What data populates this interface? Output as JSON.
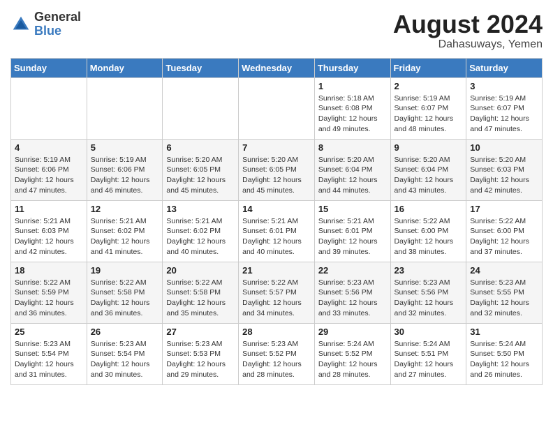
{
  "logo": {
    "general": "General",
    "blue": "Blue"
  },
  "title": {
    "month_year": "August 2024",
    "location": "Dahasuways, Yemen"
  },
  "weekdays": [
    "Sunday",
    "Monday",
    "Tuesday",
    "Wednesday",
    "Thursday",
    "Friday",
    "Saturday"
  ],
  "weeks": [
    [
      {
        "day": "",
        "info": ""
      },
      {
        "day": "",
        "info": ""
      },
      {
        "day": "",
        "info": ""
      },
      {
        "day": "",
        "info": ""
      },
      {
        "day": "1",
        "info": "Sunrise: 5:18 AM\nSunset: 6:08 PM\nDaylight: 12 hours and 49 minutes."
      },
      {
        "day": "2",
        "info": "Sunrise: 5:19 AM\nSunset: 6:07 PM\nDaylight: 12 hours and 48 minutes."
      },
      {
        "day": "3",
        "info": "Sunrise: 5:19 AM\nSunset: 6:07 PM\nDaylight: 12 hours and 47 minutes."
      }
    ],
    [
      {
        "day": "4",
        "info": "Sunrise: 5:19 AM\nSunset: 6:06 PM\nDaylight: 12 hours and 47 minutes."
      },
      {
        "day": "5",
        "info": "Sunrise: 5:19 AM\nSunset: 6:06 PM\nDaylight: 12 hours and 46 minutes."
      },
      {
        "day": "6",
        "info": "Sunrise: 5:20 AM\nSunset: 6:05 PM\nDaylight: 12 hours and 45 minutes."
      },
      {
        "day": "7",
        "info": "Sunrise: 5:20 AM\nSunset: 6:05 PM\nDaylight: 12 hours and 45 minutes."
      },
      {
        "day": "8",
        "info": "Sunrise: 5:20 AM\nSunset: 6:04 PM\nDaylight: 12 hours and 44 minutes."
      },
      {
        "day": "9",
        "info": "Sunrise: 5:20 AM\nSunset: 6:04 PM\nDaylight: 12 hours and 43 minutes."
      },
      {
        "day": "10",
        "info": "Sunrise: 5:20 AM\nSunset: 6:03 PM\nDaylight: 12 hours and 42 minutes."
      }
    ],
    [
      {
        "day": "11",
        "info": "Sunrise: 5:21 AM\nSunset: 6:03 PM\nDaylight: 12 hours and 42 minutes."
      },
      {
        "day": "12",
        "info": "Sunrise: 5:21 AM\nSunset: 6:02 PM\nDaylight: 12 hours and 41 minutes."
      },
      {
        "day": "13",
        "info": "Sunrise: 5:21 AM\nSunset: 6:02 PM\nDaylight: 12 hours and 40 minutes."
      },
      {
        "day": "14",
        "info": "Sunrise: 5:21 AM\nSunset: 6:01 PM\nDaylight: 12 hours and 40 minutes."
      },
      {
        "day": "15",
        "info": "Sunrise: 5:21 AM\nSunset: 6:01 PM\nDaylight: 12 hours and 39 minutes."
      },
      {
        "day": "16",
        "info": "Sunrise: 5:22 AM\nSunset: 6:00 PM\nDaylight: 12 hours and 38 minutes."
      },
      {
        "day": "17",
        "info": "Sunrise: 5:22 AM\nSunset: 6:00 PM\nDaylight: 12 hours and 37 minutes."
      }
    ],
    [
      {
        "day": "18",
        "info": "Sunrise: 5:22 AM\nSunset: 5:59 PM\nDaylight: 12 hours and 36 minutes."
      },
      {
        "day": "19",
        "info": "Sunrise: 5:22 AM\nSunset: 5:58 PM\nDaylight: 12 hours and 36 minutes."
      },
      {
        "day": "20",
        "info": "Sunrise: 5:22 AM\nSunset: 5:58 PM\nDaylight: 12 hours and 35 minutes."
      },
      {
        "day": "21",
        "info": "Sunrise: 5:22 AM\nSunset: 5:57 PM\nDaylight: 12 hours and 34 minutes."
      },
      {
        "day": "22",
        "info": "Sunrise: 5:23 AM\nSunset: 5:56 PM\nDaylight: 12 hours and 33 minutes."
      },
      {
        "day": "23",
        "info": "Sunrise: 5:23 AM\nSunset: 5:56 PM\nDaylight: 12 hours and 32 minutes."
      },
      {
        "day": "24",
        "info": "Sunrise: 5:23 AM\nSunset: 5:55 PM\nDaylight: 12 hours and 32 minutes."
      }
    ],
    [
      {
        "day": "25",
        "info": "Sunrise: 5:23 AM\nSunset: 5:54 PM\nDaylight: 12 hours and 31 minutes."
      },
      {
        "day": "26",
        "info": "Sunrise: 5:23 AM\nSunset: 5:54 PM\nDaylight: 12 hours and 30 minutes."
      },
      {
        "day": "27",
        "info": "Sunrise: 5:23 AM\nSunset: 5:53 PM\nDaylight: 12 hours and 29 minutes."
      },
      {
        "day": "28",
        "info": "Sunrise: 5:23 AM\nSunset: 5:52 PM\nDaylight: 12 hours and 28 minutes."
      },
      {
        "day": "29",
        "info": "Sunrise: 5:24 AM\nSunset: 5:52 PM\nDaylight: 12 hours and 28 minutes."
      },
      {
        "day": "30",
        "info": "Sunrise: 5:24 AM\nSunset: 5:51 PM\nDaylight: 12 hours and 27 minutes."
      },
      {
        "day": "31",
        "info": "Sunrise: 5:24 AM\nSunset: 5:50 PM\nDaylight: 12 hours and 26 minutes."
      }
    ]
  ]
}
